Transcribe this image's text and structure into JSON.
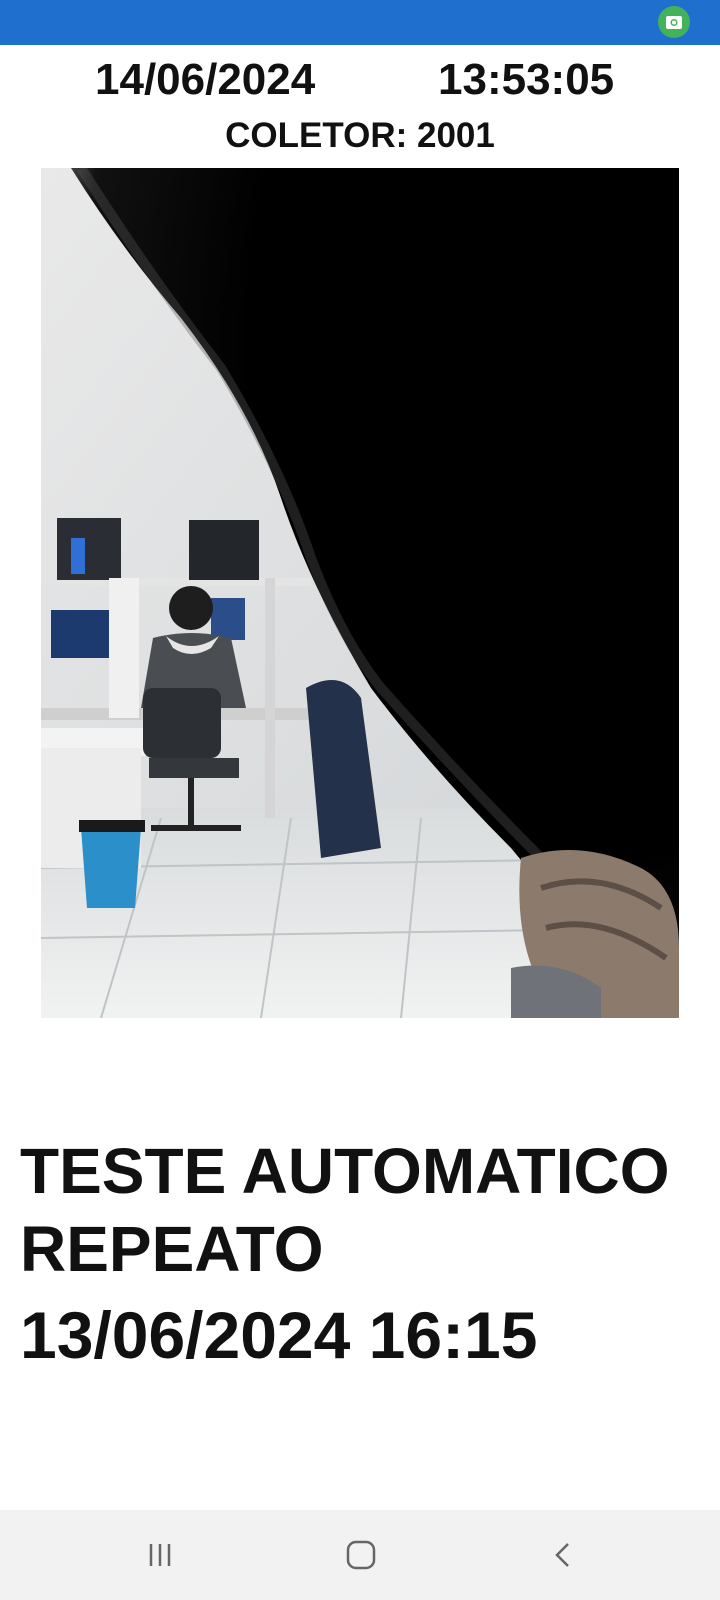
{
  "status_bar": {
    "color": "#1f6fcf",
    "indicator_icon": "camera-icon",
    "indicator_color": "#43b35b"
  },
  "header": {
    "date": "14/06/2024",
    "time": "13:53:05",
    "collector": "COLETOR: 2001"
  },
  "photo": {
    "icon": "camera-capture"
  },
  "message": {
    "line1": "TESTE AUTOMATICO",
    "line2": "REPEATO",
    "timestamp": "13/06/2024 16:15"
  },
  "nav": {
    "recents_icon": "recents-icon",
    "home_icon": "home-icon",
    "back_icon": "back-icon"
  }
}
